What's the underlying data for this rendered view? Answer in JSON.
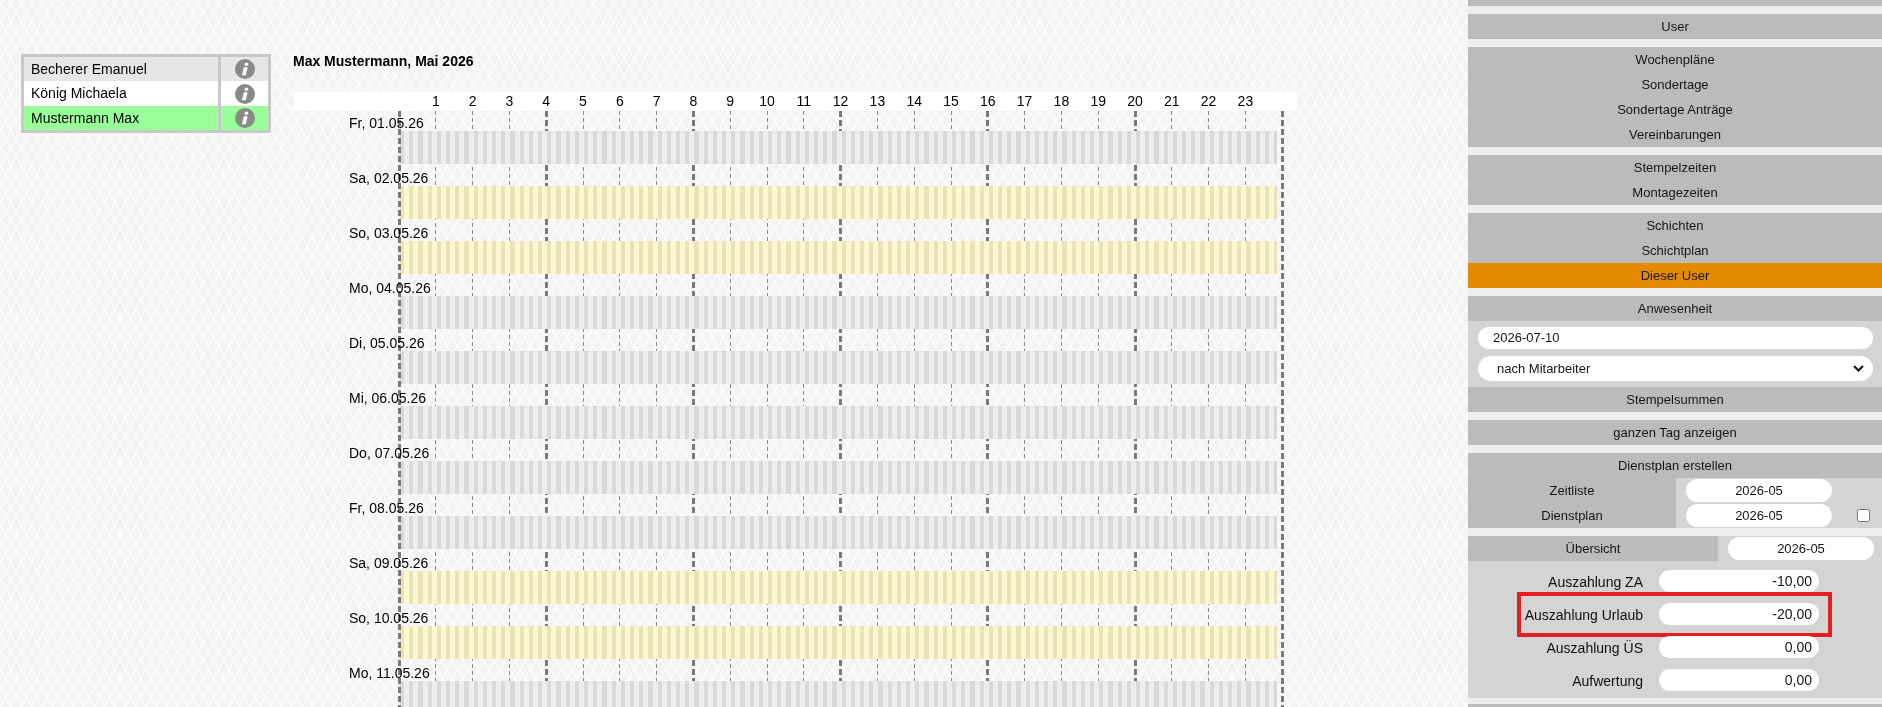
{
  "employees": [
    {
      "name": "Becherer Emanuel",
      "selected": false
    },
    {
      "name": "König Michaela",
      "selected": false
    },
    {
      "name": "Mustermann Max",
      "selected": true
    }
  ],
  "schedule": {
    "title": "Max Mustermann, Mai 2026",
    "hours": [
      "1",
      "2",
      "3",
      "4",
      "5",
      "6",
      "7",
      "8",
      "9",
      "10",
      "11",
      "12",
      "13",
      "14",
      "15",
      "16",
      "17",
      "18",
      "19",
      "20",
      "21",
      "22",
      "23"
    ],
    "days": [
      {
        "label": "Fr, 01.05.26",
        "weekend": false
      },
      {
        "label": "Sa, 02.05.26",
        "weekend": true
      },
      {
        "label": "So, 03.05.26",
        "weekend": true
      },
      {
        "label": "Mo, 04.05.26",
        "weekend": false
      },
      {
        "label": "Di, 05.05.26",
        "weekend": false
      },
      {
        "label": "Mi, 06.05.26",
        "weekend": false
      },
      {
        "label": "Do, 07.05.26",
        "weekend": false
      },
      {
        "label": "Fr, 08.05.26",
        "weekend": false
      },
      {
        "label": "Sa, 09.05.26",
        "weekend": true
      },
      {
        "label": "So, 10.05.26",
        "weekend": true
      },
      {
        "label": "Mo, 11.05.26",
        "weekend": false
      }
    ]
  },
  "side_panel": {
    "menu_groups": [
      {
        "items": [
          {
            "label": "User",
            "selected": false
          }
        ]
      },
      {
        "items": [
          {
            "label": "Wochenpläne",
            "selected": false
          },
          {
            "label": "Sondertage",
            "selected": false
          },
          {
            "label": "Sondertage Anträge",
            "selected": false
          },
          {
            "label": "Vereinbarungen",
            "selected": false
          }
        ]
      },
      {
        "items": [
          {
            "label": "Stempelzeiten",
            "selected": false
          },
          {
            "label": "Montagezeiten",
            "selected": false
          }
        ]
      },
      {
        "items": [
          {
            "label": "Schichten",
            "selected": false
          },
          {
            "label": "Schichtplan",
            "selected": false
          },
          {
            "label": "Dieser User",
            "selected": true
          }
        ]
      }
    ],
    "attendance": {
      "title": "Anwesenheit",
      "date": "2026-07-10",
      "view": "nach Mitarbeiter",
      "button": "Stempelsummen"
    },
    "full_day_button": "ganzen Tag anzeigen",
    "roster": {
      "title": "Dienstplan erstellen",
      "rows": [
        {
          "label": "Zeitliste",
          "value": "2026-05"
        },
        {
          "label": "Dienstplan",
          "value": "2026-05"
        }
      ],
      "checkbox": {
        "checked": false
      }
    },
    "overview": {
      "label": "Übersicht",
      "value": "2026-05",
      "rows": [
        {
          "label": "Auszahlung ZA",
          "value": "-10,00",
          "highlighted": false
        },
        {
          "label": "Auszahlung Urlaub",
          "value": "-20,00",
          "highlighted": true
        },
        {
          "label": "Auszahlung ÜS",
          "value": "0,00",
          "highlighted": false
        },
        {
          "label": "Aufwertung",
          "value": "0,00",
          "highlighted": false
        }
      ]
    }
  }
}
